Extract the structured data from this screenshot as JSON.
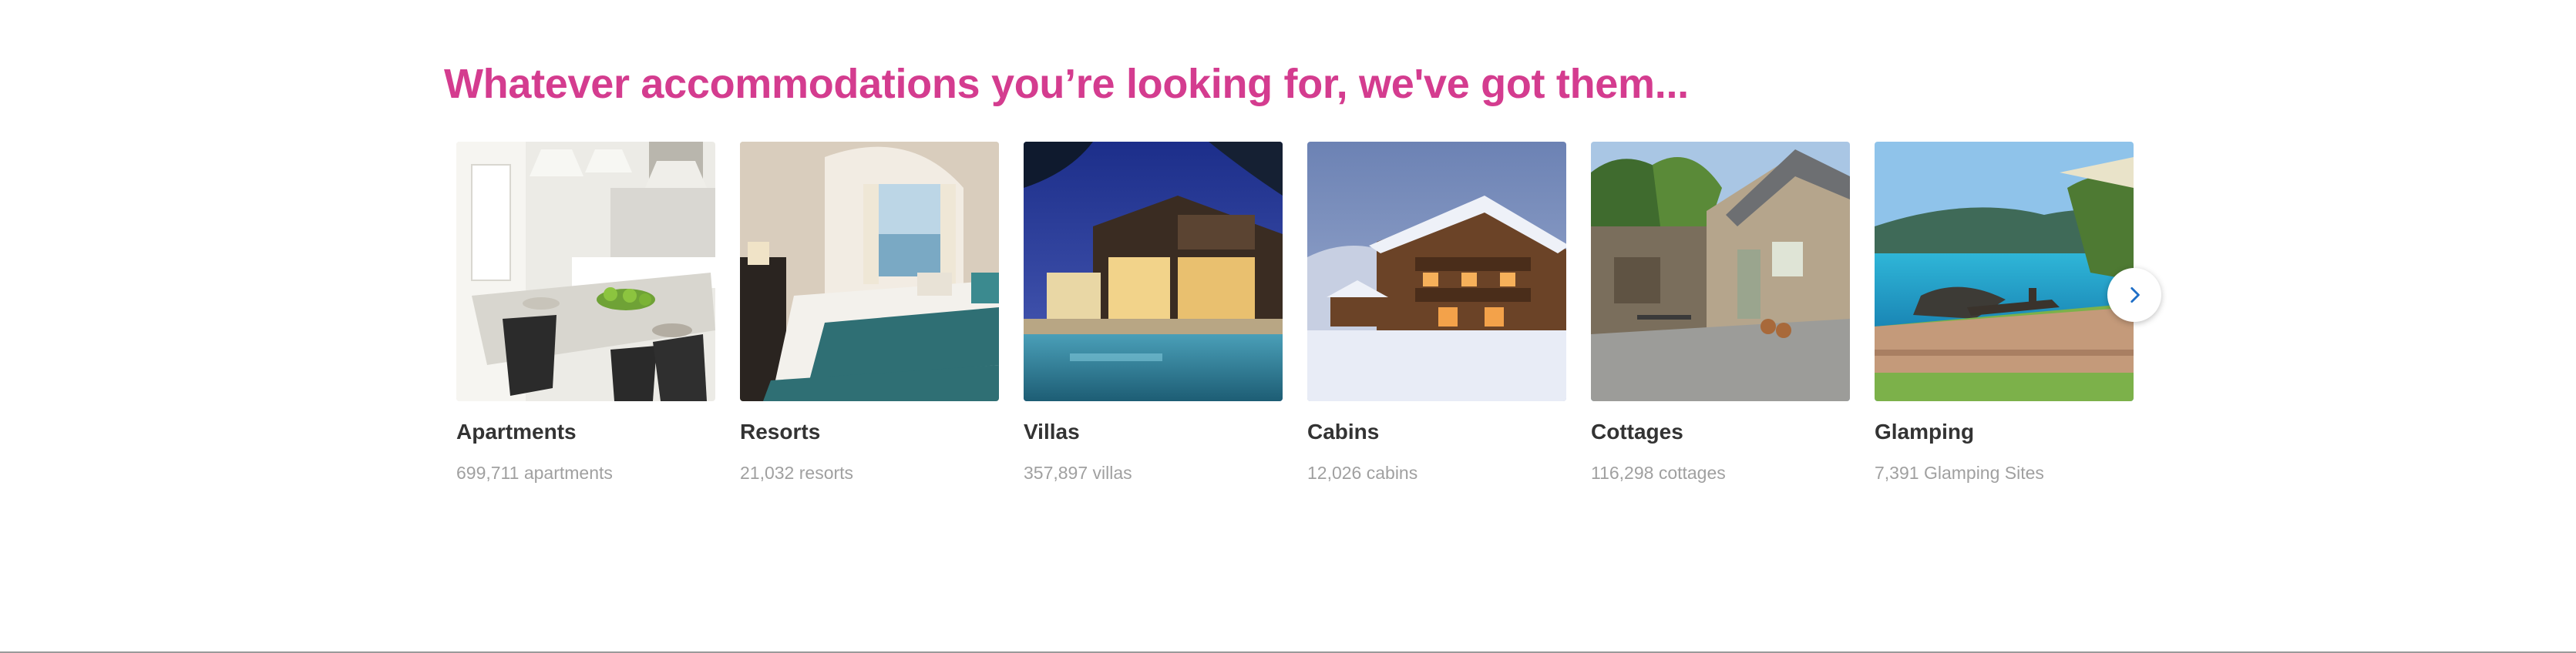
{
  "section": {
    "title": "Whatever accommodations you’re looking for, we've got them..."
  },
  "colors": {
    "title": "#d43c8f",
    "card_title": "#333333",
    "card_count": "#a0a0a0",
    "next_icon": "#1f6fc7"
  },
  "cards": [
    {
      "title": "Apartments",
      "count": "699,711 apartments",
      "image": "apartment-kitchen-photo"
    },
    {
      "title": "Resorts",
      "count": "21,032 resorts",
      "image": "resort-bedroom-photo"
    },
    {
      "title": "Villas",
      "count": "357,897 villas",
      "image": "villa-pool-night-photo"
    },
    {
      "title": "Cabins",
      "count": "12,026 cabins",
      "image": "snowy-cabin-photo"
    },
    {
      "title": "Cottages",
      "count": "116,298 cottages",
      "image": "stone-cottage-photo"
    },
    {
      "title": "Glamping",
      "count": "7,391 Glamping Sites",
      "image": "glamping-deck-sea-photo"
    }
  ],
  "carousel": {
    "next_icon": "chevron-right-icon"
  }
}
